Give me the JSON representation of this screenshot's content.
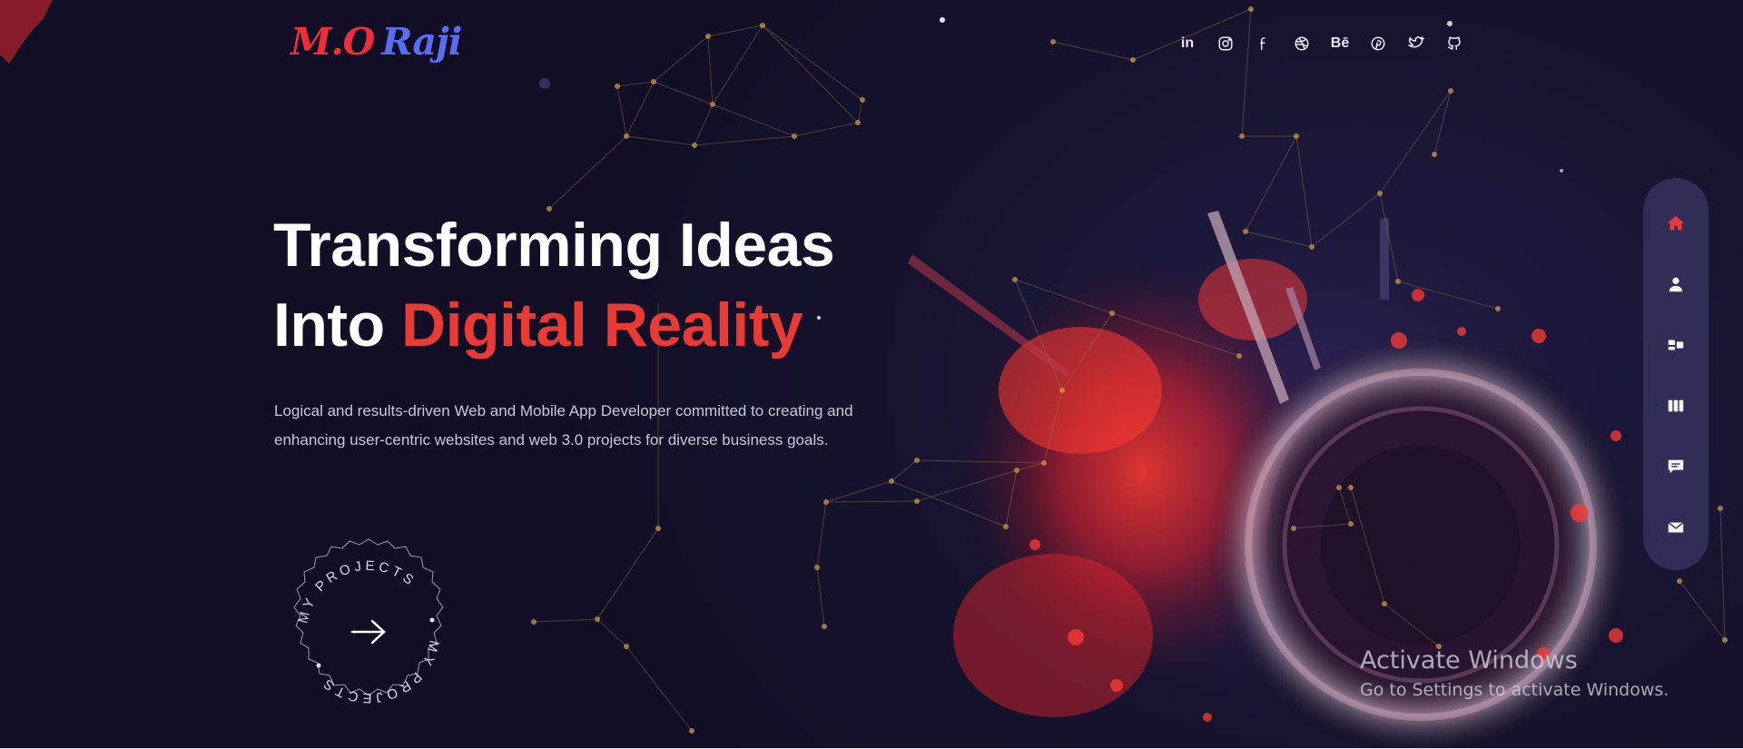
{
  "logo": {
    "part1": "M.O",
    "part2": "Raji"
  },
  "social": {
    "linkedin_label": "in",
    "behance_label": "Bē",
    "icons": [
      "linkedin-icon",
      "instagram-icon",
      "facebook-icon",
      "dribbble-icon",
      "behance-icon",
      "pinterest-icon",
      "twitter-icon",
      "github-icon"
    ]
  },
  "hero": {
    "title_line1": "Transforming Ideas",
    "title_line2_prefix": "Into ",
    "title_line2_accent": "Digital Reality",
    "subtitle_line1": "Logical and results-driven Web and Mobile App Developer committed to creating and",
    "subtitle_line2": "enhancing user-centric websites and web 3.0 projects for diverse business goals."
  },
  "badge": {
    "circle_text": "MY PROJECTS",
    "arrow_icon": "arrow-right-icon"
  },
  "dock": {
    "items": [
      "home-icon",
      "user-icon",
      "services-icon",
      "portfolio-icon",
      "testimonials-icon",
      "mail-icon"
    ],
    "active": "home-icon"
  },
  "watermark": {
    "title": "Activate Windows",
    "subtitle": "Go to Settings to activate Windows."
  },
  "colors": {
    "accent": "#ea3a35",
    "logo_red": "#ef2d3b",
    "logo_blue": "#5b6cf0",
    "background": "#14112a",
    "dock": "#3a3460"
  }
}
